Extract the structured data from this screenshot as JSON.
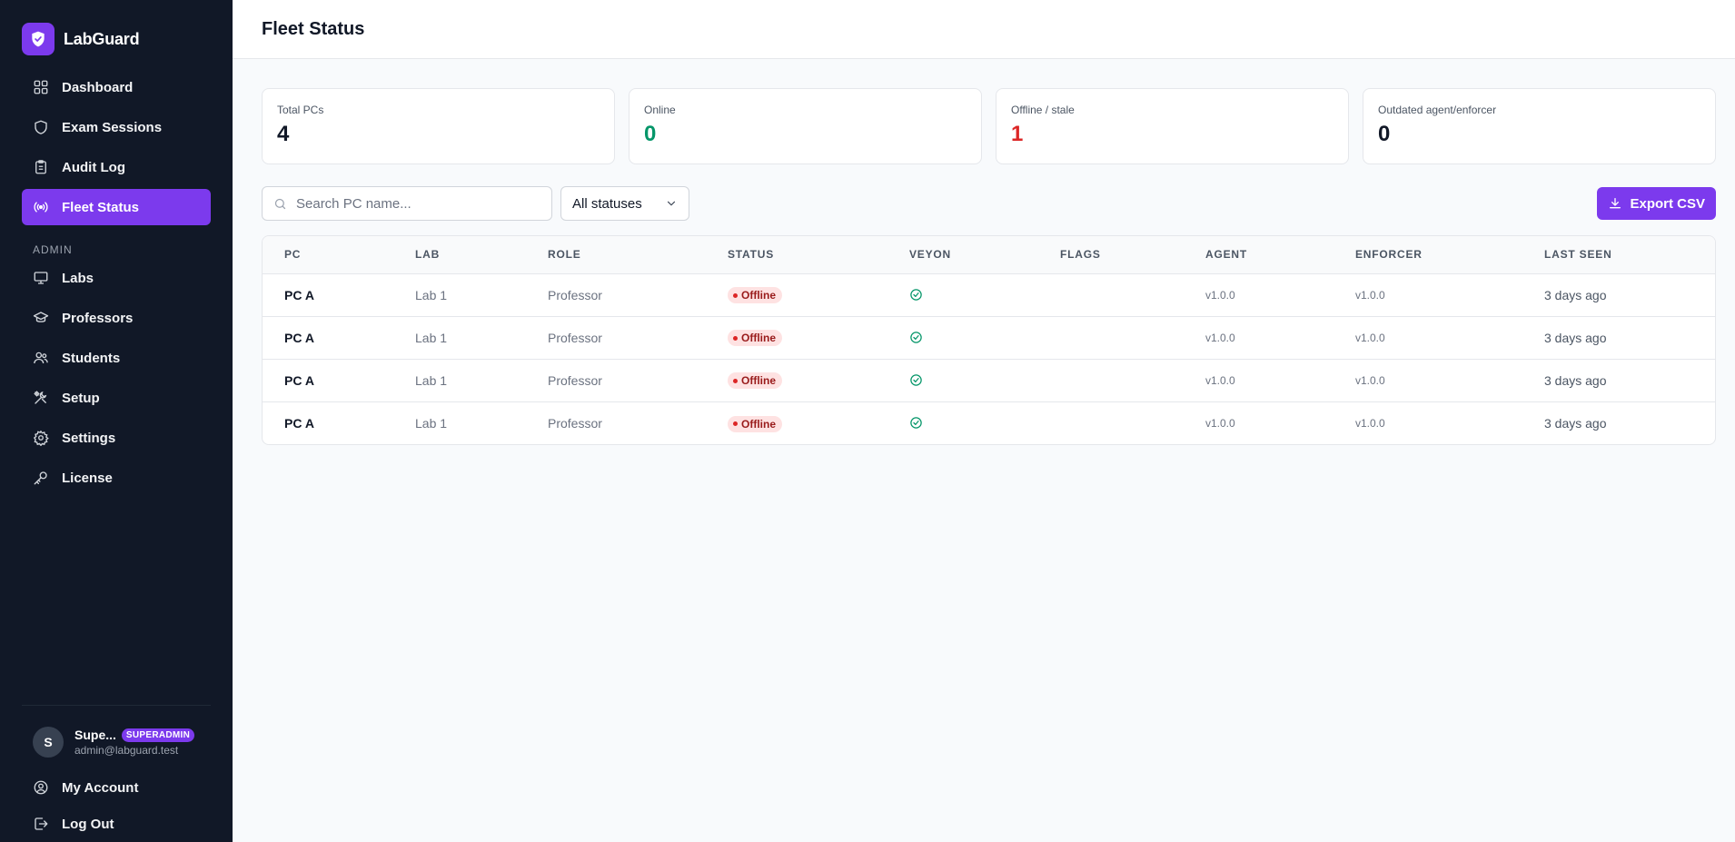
{
  "brand": {
    "name": "LabGuard"
  },
  "colors": {
    "accent": "#7c3aed",
    "sidebar_bg": "#111827",
    "online": "#059669",
    "offline": "#dc2626"
  },
  "sidebar": {
    "items": [
      {
        "label": "Dashboard",
        "icon": "dashboard-icon"
      },
      {
        "label": "Exam Sessions",
        "icon": "shield-icon"
      },
      {
        "label": "Audit Log",
        "icon": "clipboard-icon"
      },
      {
        "label": "Fleet Status",
        "icon": "broadcast-icon",
        "active": true
      }
    ],
    "admin_label": "ADMIN",
    "admin_items": [
      {
        "label": "Labs",
        "icon": "monitor-icon"
      },
      {
        "label": "Professors",
        "icon": "graduation-cap-icon"
      },
      {
        "label": "Students",
        "icon": "users-icon"
      },
      {
        "label": "Setup",
        "icon": "tools-icon"
      },
      {
        "label": "Settings",
        "icon": "gear-icon"
      },
      {
        "label": "License",
        "icon": "key-icon"
      }
    ],
    "user": {
      "initial": "S",
      "name": "Supe...",
      "role": "SUPERADMIN",
      "email": "admin@labguard.test"
    },
    "bottom_items": [
      {
        "label": "My Account",
        "icon": "user-circle-icon"
      },
      {
        "label": "Log Out",
        "icon": "logout-icon"
      }
    ]
  },
  "header": {
    "title": "Fleet Status"
  },
  "stats": [
    {
      "label": "Total PCs",
      "value": "4"
    },
    {
      "label": "Online",
      "value": "0"
    },
    {
      "label": "Offline / stale",
      "value": "1"
    },
    {
      "label": "Outdated agent/enforcer",
      "value": "0"
    }
  ],
  "search": {
    "placeholder": "Search PC name...",
    "value": ""
  },
  "status_filter": {
    "selected": "All statuses"
  },
  "export_label": "Export CSV",
  "table": {
    "columns": [
      "PC",
      "LAB",
      "ROLE",
      "STATUS",
      "VEYON",
      "FLAGS",
      "AGENT",
      "ENFORCER",
      "LAST SEEN"
    ],
    "rows": [
      {
        "pc": "PC A",
        "lab": "Lab 1",
        "role": "Professor",
        "status": "Offline",
        "veyon": "check-circle-icon",
        "flags": "",
        "agent": "v1.0.0",
        "enforcer": "v1.0.0",
        "last_seen": "3 days ago"
      },
      {
        "pc": "PC A",
        "lab": "Lab 1",
        "role": "Professor",
        "status": "Offline",
        "veyon": "check-circle-icon",
        "flags": "",
        "agent": "v1.0.0",
        "enforcer": "v1.0.0",
        "last_seen": "3 days ago"
      },
      {
        "pc": "PC A",
        "lab": "Lab 1",
        "role": "Professor",
        "status": "Offline",
        "veyon": "check-circle-icon",
        "flags": "",
        "agent": "v1.0.0",
        "enforcer": "v1.0.0",
        "last_seen": "3 days ago"
      },
      {
        "pc": "PC A",
        "lab": "Lab 1",
        "role": "Professor",
        "status": "Offline",
        "veyon": "check-circle-icon",
        "flags": "",
        "agent": "v1.0.0",
        "enforcer": "v1.0.0",
        "last_seen": "3 days ago"
      }
    ]
  }
}
